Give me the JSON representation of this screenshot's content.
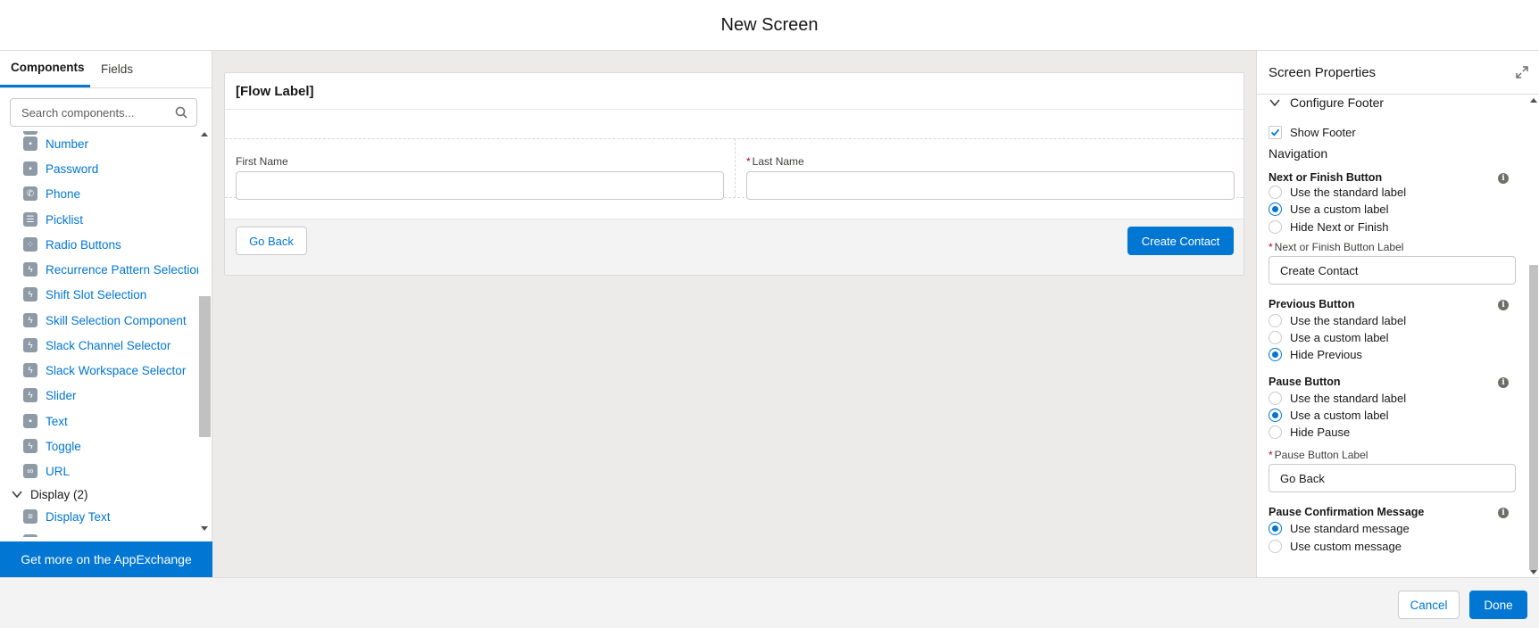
{
  "header": {
    "title": "New Screen"
  },
  "left_panel": {
    "tabs": [
      {
        "label": "Components",
        "active": true
      },
      {
        "label": "Fields",
        "active": false
      }
    ],
    "search": {
      "placeholder": "Search components..."
    },
    "items": [
      {
        "label": "Number",
        "icon": "number-icon"
      },
      {
        "label": "Password",
        "icon": "password-icon"
      },
      {
        "label": "Phone",
        "icon": "phone-icon"
      },
      {
        "label": "Picklist",
        "icon": "picklist-icon"
      },
      {
        "label": "Radio Buttons",
        "icon": "radio-buttons-icon"
      },
      {
        "label": "Recurrence Pattern Selection",
        "icon": "lightning-icon"
      },
      {
        "label": "Shift Slot Selection",
        "icon": "lightning-icon"
      },
      {
        "label": "Skill Selection Component",
        "icon": "lightning-icon"
      },
      {
        "label": "Slack Channel Selector",
        "icon": "lightning-icon"
      },
      {
        "label": "Slack Workspace Selector",
        "icon": "lightning-icon"
      },
      {
        "label": "Slider",
        "icon": "lightning-icon"
      },
      {
        "label": "Text",
        "icon": "text-icon"
      },
      {
        "label": "Toggle",
        "icon": "lightning-icon"
      },
      {
        "label": "URL",
        "icon": "url-icon"
      }
    ],
    "display_section": {
      "label": "Display (2)"
    },
    "display_items": [
      {
        "label": "Display Text",
        "icon": "display-text-icon"
      }
    ],
    "appexchange": "Get more on the AppExchange"
  },
  "canvas": {
    "flow_label": "[Flow Label]",
    "fields": [
      {
        "label": "First Name",
        "required": false
      },
      {
        "label": "Last Name",
        "required": true,
        "required_marker": "*"
      }
    ],
    "go_back_label": "Go Back",
    "create_contact_label": "Create Contact"
  },
  "properties": {
    "title": "Screen Properties",
    "configure_footer": "Configure Footer",
    "show_footer": "Show Footer",
    "navigation": "Navigation",
    "next_finish": {
      "title": "Next or Finish Button",
      "options": [
        "Use the standard label",
        "Use a custom label",
        "Hide Next or Finish"
      ],
      "selected": 1,
      "input_label": "Next or Finish Button Label",
      "input_value": "Create Contact"
    },
    "previous": {
      "title": "Previous Button",
      "options": [
        "Use the standard label",
        "Use a custom label",
        "Hide Previous"
      ],
      "selected": 2
    },
    "pause": {
      "title": "Pause Button",
      "options": [
        "Use the standard label",
        "Use a custom label",
        "Hide Pause"
      ],
      "selected": 1,
      "input_label": "Pause Button Label",
      "input_value": "Go Back"
    },
    "pause_confirmation": {
      "title": "Pause Confirmation Message",
      "options": [
        "Use standard message",
        "Use custom message"
      ],
      "selected": 0
    },
    "required_marker": "*",
    "info_glyph": "i"
  },
  "footer": {
    "cancel_label": "Cancel",
    "done_label": "Done"
  },
  "colors": {
    "brand": "#0176d3",
    "required": "#ba0517",
    "canvas_bg": "#ecebea",
    "icon_gray": "#8e9aa6"
  }
}
